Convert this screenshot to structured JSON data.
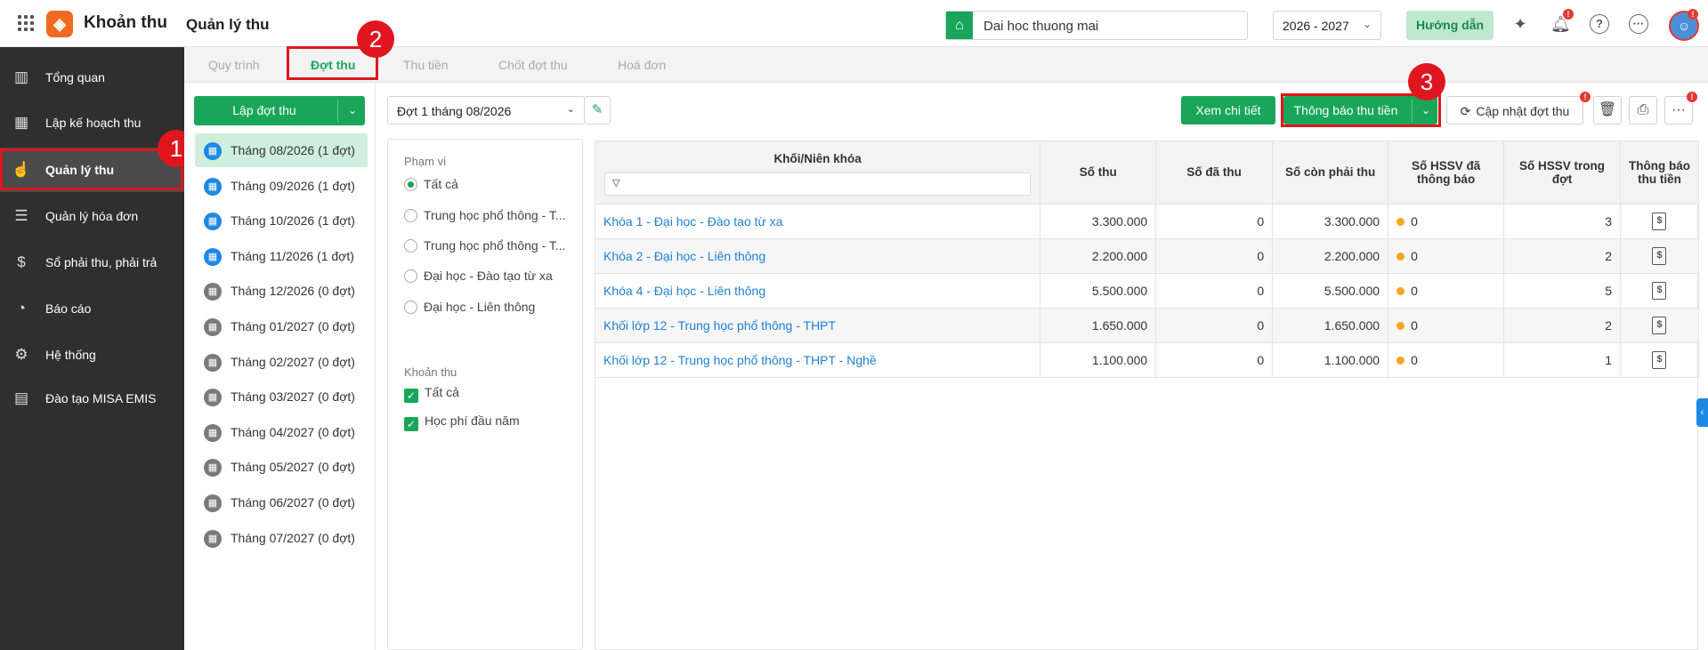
{
  "app": {
    "title": "Khoản thu",
    "page_title": "Quản lý thu",
    "logo_icon": "box-icon"
  },
  "header": {
    "school": "Dai hoc thuong mai",
    "year": "2026 - 2027",
    "guide": "Hướng dẫn"
  },
  "sidebar": {
    "items": [
      {
        "label": "Tổng quan",
        "icon": "chart-icon"
      },
      {
        "label": "Lập kế hoạch thu",
        "icon": "calendar-money-icon"
      },
      {
        "label": "Quản lý thu",
        "icon": "hand-coin-icon"
      },
      {
        "label": "Quản lý hóa đơn",
        "icon": "invoice-icon"
      },
      {
        "label": "Sổ phải thu, phải trả",
        "icon": "ledger-icon"
      },
      {
        "label": "Báo cáo",
        "icon": "pie-chart-icon"
      },
      {
        "label": "Hệ thống",
        "icon": "gear-icon"
      },
      {
        "label": "Đào tạo MISA EMIS",
        "icon": "book-icon"
      }
    ]
  },
  "tabs": [
    "Quy trình",
    "Đợt thu",
    "Thu tiền",
    "Chốt đợt thu",
    "Hoá đơn"
  ],
  "callouts": [
    "1",
    "2",
    "3"
  ],
  "left": {
    "create_button": "Lập đợt thu",
    "periods": [
      "Tháng 08/2026 (1 đợt)",
      "Tháng 09/2026 (1 đợt)",
      "Tháng 10/2026 (1 đợt)",
      "Tháng 11/2026 (1 đợt)",
      "Tháng 12/2026 (0 đợt)",
      "Tháng 01/2027 (0 đợt)",
      "Tháng 02/2027 (0 đợt)",
      "Tháng 03/2027 (0 đợt)",
      "Tháng 04/2027 (0 đợt)",
      "Tháng 05/2027 (0 đợt)",
      "Tháng 06/2027 (0 đợt)",
      "Tháng 07/2027 (0 đợt)"
    ]
  },
  "batch_select": "Đợt 1 tháng 08/2026",
  "filter": {
    "scope_title": "Phạm vi",
    "scope_options": [
      "Tất cả",
      "Trung học phổ thông - T...",
      "Trung học phổ thông - T...",
      "Đại học - Đào tạo từ xa",
      "Đại học - Liên thông"
    ],
    "fee_title": "Khoản thu",
    "fee_options": [
      "Tất cả",
      "Học phí đầu năm"
    ]
  },
  "actions": {
    "view_detail": "Xem chi tiết",
    "notify": "Thông báo thu tiền",
    "update": "Cập nhật đợt thu"
  },
  "table": {
    "headers": [
      "Khối/Niên khóa",
      "Số thu",
      "Số đã thu",
      "Số còn phải thu",
      "Số HSSV đã thông báo",
      "Số HSSV trong đợt",
      "Thông báo thu tiền"
    ],
    "rows": [
      {
        "name": "Khóa 1 - Đại học - Đào tạo từ xa",
        "so_thu": "3.300.000",
        "da_thu": "0",
        "con_phai_thu": "3.300.000",
        "da_thong_bao": "0",
        "trong_dot": "3"
      },
      {
        "name": "Khóa 2 - Đại học - Liên thông",
        "so_thu": "2.200.000",
        "da_thu": "0",
        "con_phai_thu": "2.200.000",
        "da_thong_bao": "0",
        "trong_dot": "2"
      },
      {
        "name": "Khóa 4 - Đại học - Liên thông",
        "so_thu": "5.500.000",
        "da_thu": "0",
        "con_phai_thu": "5.500.000",
        "da_thong_bao": "0",
        "trong_dot": "5"
      },
      {
        "name": "Khối lớp 12 - Trung học phổ thông - THPT",
        "so_thu": "1.650.000",
        "da_thu": "0",
        "con_phai_thu": "1.650.000",
        "da_thong_bao": "0",
        "trong_dot": "2"
      },
      {
        "name": "Khối lớp 12 - Trung học phổ thông - THPT - Nghề",
        "so_thu": "1.100.000",
        "da_thu": "0",
        "con_phai_thu": "1.100.000",
        "da_thong_bao": "0",
        "trong_dot": "1"
      }
    ]
  },
  "colors": {
    "primary": "#1aa65a",
    "sidebar": "#2f2f2f",
    "highlight": "#e0161e",
    "link": "#1e7fd6"
  }
}
